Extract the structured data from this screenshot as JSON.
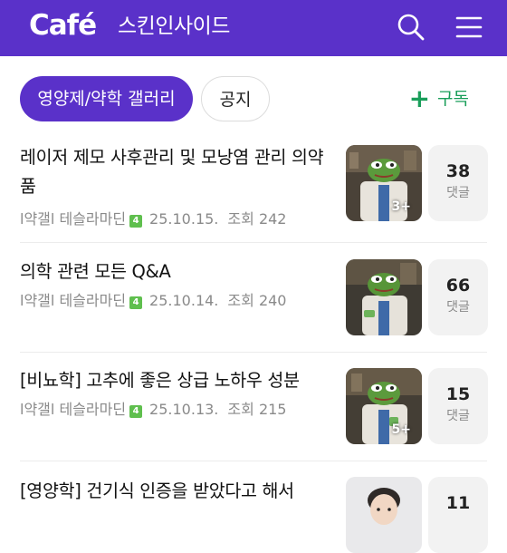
{
  "header": {
    "logo": "Café",
    "cafe_name": "스킨인사이드",
    "search_icon": "search-icon",
    "menu_icon": "hamburger-menu-icon",
    "background": "#5a31c9"
  },
  "tabs": [
    {
      "label": "영양제/약학 갤러리",
      "active": true
    },
    {
      "label": "공지",
      "active": false
    }
  ],
  "subscribe": {
    "plus": "+",
    "label": "구독",
    "color": "#1a9e5a"
  },
  "posts": [
    {
      "title": "레이저 제모 사후관리 및 모낭염 관리 의약품",
      "board": "l약갤l",
      "author": "테슬라마딘",
      "level": "4",
      "date": "25.10.15.",
      "views_label": "조회",
      "views": "242",
      "thumb_count": "3+",
      "comments": "38",
      "comments_label": "댓글"
    },
    {
      "title": "의학 관련 모든 Q&A",
      "board": "l약갤l",
      "author": "테슬라마딘",
      "level": "4",
      "date": "25.10.14.",
      "views_label": "조회",
      "views": "240",
      "thumb_count": "",
      "comments": "66",
      "comments_label": "댓글"
    },
    {
      "title": "[비뇨학] 고추에 좋은 상급 노하우 성분",
      "board": "l약갤l",
      "author": "테슬라마딘",
      "level": "4",
      "date": "25.10.13.",
      "views_label": "조회",
      "views": "215",
      "thumb_count": "5+",
      "comments": "15",
      "comments_label": "댓글"
    },
    {
      "title": "[영양학] 건기식 인증을 받았다고 해서",
      "comments": "11"
    }
  ]
}
